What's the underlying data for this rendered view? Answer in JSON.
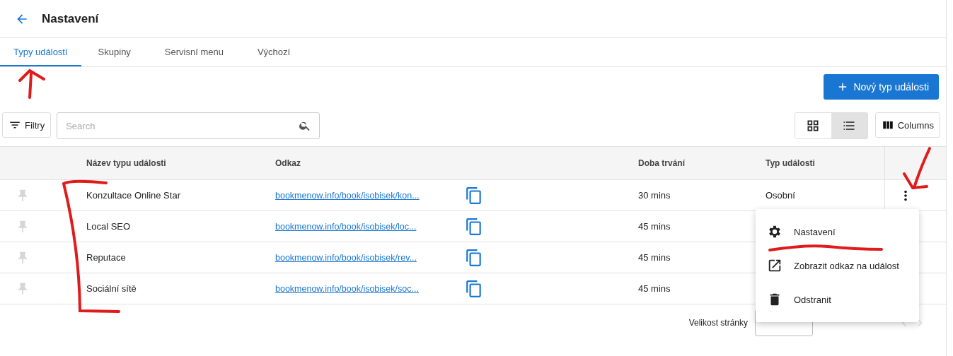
{
  "header": {
    "title": "Nastavení"
  },
  "tabs": [
    {
      "label": "Typy událostí",
      "selected": true
    },
    {
      "label": "Skupiny",
      "selected": false
    },
    {
      "label": "Servisní menu",
      "selected": false
    },
    {
      "label": "Výchozí",
      "selected": false
    }
  ],
  "new_button": {
    "label": "Nový typ události"
  },
  "toolbar": {
    "filter_label": "Filtry",
    "search": {
      "placeholder": "Search"
    },
    "views": [
      {
        "kind": "grid",
        "selected": false
      },
      {
        "kind": "list",
        "selected": true
      }
    ],
    "columns_label": "Columns"
  },
  "table": {
    "columns": [
      "Název typu události",
      "Odkaz",
      "Doba trvání",
      "Typ události"
    ],
    "rows": [
      {
        "pinned": false,
        "name": "Konzultace Online Star",
        "link": "bookmenow.info/book/isobisek/kon...",
        "duration": "30 mins",
        "type": "Osobní"
      },
      {
        "pinned": false,
        "name": "Local SEO",
        "link": "bookmenow.info/book/isobisek/loc...",
        "duration": "45 mins"
      },
      {
        "pinned": false,
        "name": "Reputace",
        "link": "bookmenow.info/book/isobisek/rev...",
        "duration": "45 mins"
      },
      {
        "pinned": false,
        "name": "Sociální sítě",
        "link": "bookmenow.info/book/isobisek/soc...",
        "duration": "45 mins"
      }
    ]
  },
  "row_menu": [
    {
      "kind": "settings",
      "label": "Nastavení"
    },
    {
      "kind": "open",
      "label": "Zobrazit odkaz na událost"
    },
    {
      "kind": "delete",
      "label": "Odstranit"
    }
  ],
  "pagination": {
    "page_size_label": "Velikost stránky"
  }
}
